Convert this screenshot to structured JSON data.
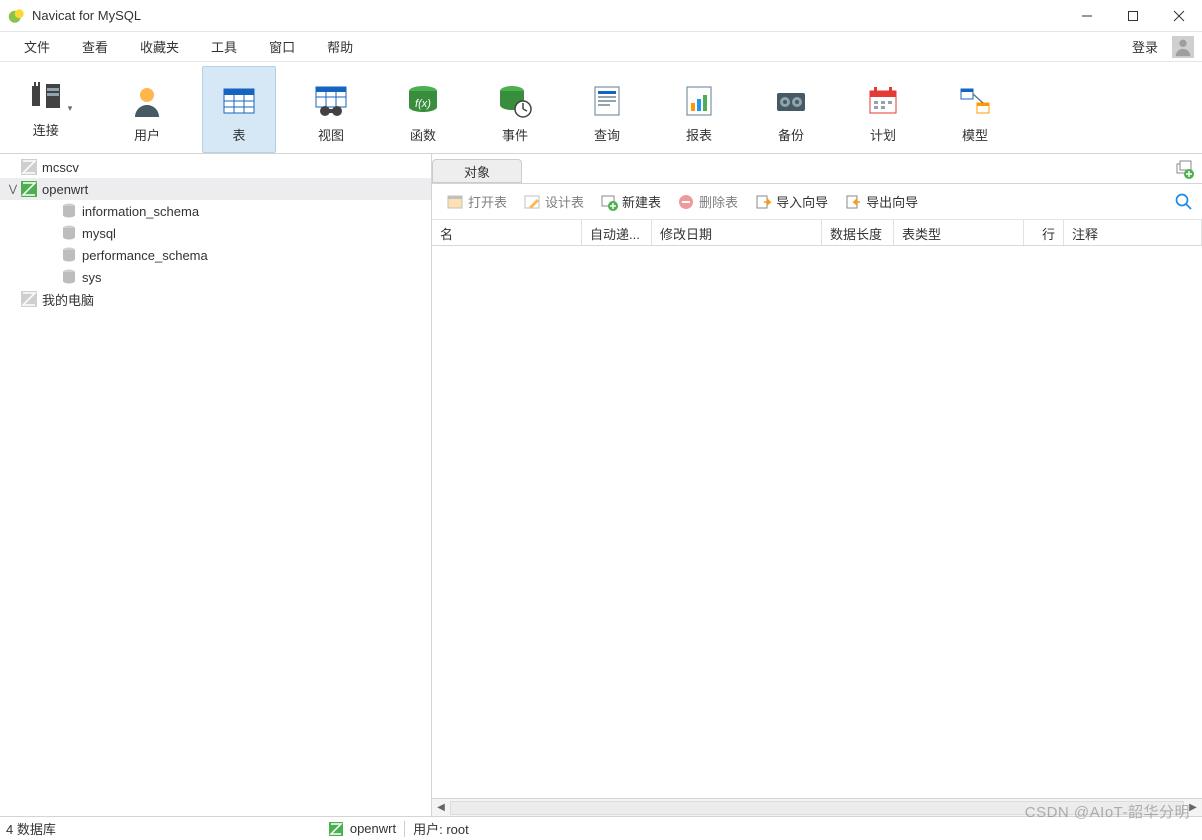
{
  "app": {
    "title": "Navicat for MySQL"
  },
  "menu": {
    "items": [
      "文件",
      "查看",
      "收藏夹",
      "工具",
      "窗口",
      "帮助"
    ],
    "login": "登录"
  },
  "toolbar": {
    "connect": "连接",
    "user": "用户",
    "table": "表",
    "view": "视图",
    "function": "函数",
    "event": "事件",
    "query": "查询",
    "report": "报表",
    "backup": "备份",
    "schedule": "计划",
    "model": "模型"
  },
  "tree": {
    "nodes": [
      {
        "label": "mcscv",
        "type": "connection",
        "open": false,
        "depth": 0
      },
      {
        "label": "openwrt",
        "type": "connection",
        "open": true,
        "expanded": true,
        "selected": true,
        "depth": 0
      },
      {
        "label": "information_schema",
        "type": "database",
        "depth": 1
      },
      {
        "label": "mysql",
        "type": "database",
        "depth": 1
      },
      {
        "label": "performance_schema",
        "type": "database",
        "depth": 1
      },
      {
        "label": "sys",
        "type": "database",
        "depth": 1
      },
      {
        "label": "我的电脑",
        "type": "connection",
        "open": false,
        "depth": 0
      }
    ]
  },
  "tabs": {
    "object": "对象"
  },
  "actions": {
    "open_table": "打开表",
    "design_table": "设计表",
    "new_table": "新建表",
    "delete_table": "删除表",
    "import_wizard": "导入向导",
    "export_wizard": "导出向导"
  },
  "columns": {
    "name": "名",
    "auto_increment": "自动递...",
    "modify_date": "修改日期",
    "data_length": "数据长度",
    "table_type": "表类型",
    "rows": "行",
    "comment": "注释"
  },
  "status": {
    "db_count": "4 数据库",
    "connection": "openwrt",
    "user_label": "用户: root"
  },
  "watermark": "CSDN @AIoT-韶华分明"
}
